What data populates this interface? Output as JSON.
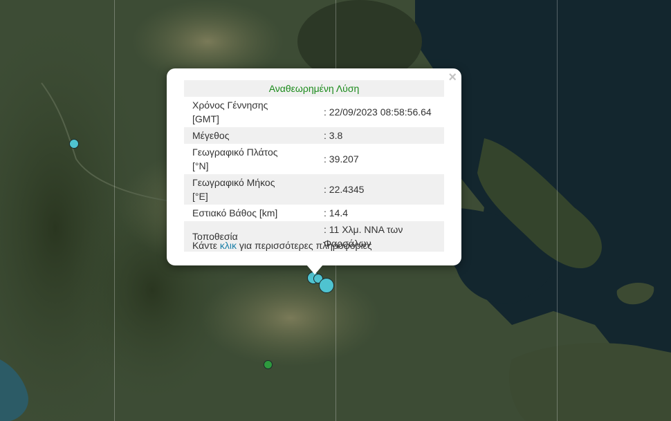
{
  "popup": {
    "close_icon": "close-icon",
    "title": "Αναθεωρημένη Λύση",
    "rows": [
      {
        "label": "Χρόνος Γέννησης [GMT]",
        "value": ": 22/09/2023 08:58:56.64"
      },
      {
        "label": "Μέγεθος",
        "value": ": 3.8"
      },
      {
        "label": "Γεωγραφικό Πλάτος [°N]",
        "value": ": 39.207"
      },
      {
        "label": "Γεωγραφικό Μήκος [°E]",
        "value": ": 22.4345"
      },
      {
        "label": "Εστιακό Βάθος [km]",
        "value": ": 14.4"
      },
      {
        "label": "Τοποθεσία",
        "value": ": 11 Χλμ. ΝΝΑ των Φαρσάλων"
      }
    ],
    "more_prefix": "Κάντε ",
    "more_link": "κλικ",
    "more_suffix": " για περισσότερες πληροφορίες"
  },
  "colors": {
    "quake_cyan": "#4fc3d0",
    "quake_green": "#2e9a3e",
    "title_green": "#1a8a1a",
    "link_blue": "#1a7fa8",
    "sea": "#13262e"
  }
}
